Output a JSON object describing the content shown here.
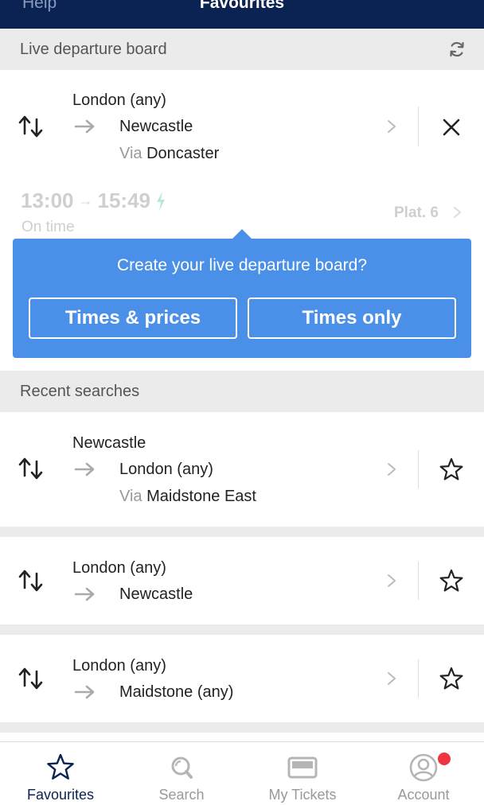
{
  "header": {
    "left": "Help",
    "title": "Favourites"
  },
  "live_board": {
    "title": "Live departure board",
    "journey": {
      "from": "London (any)",
      "to": "Newcastle",
      "via_label": "Via",
      "via": "Doncaster"
    },
    "departure": "13:00",
    "arrival": "15:49",
    "status": "On time",
    "platform": "Plat. 6"
  },
  "popup": {
    "question": "Create your live departure board?",
    "btn_times_prices": "Times & prices",
    "btn_times_only": "Times only"
  },
  "recent": {
    "title": "Recent searches",
    "items": [
      {
        "from": "Newcastle",
        "to": "London (any)",
        "via_label": "Via",
        "via": "Maidstone East"
      },
      {
        "from": "London (any)",
        "to": "Newcastle"
      },
      {
        "from": "London (any)",
        "to": "Maidstone (any)"
      }
    ]
  },
  "tabs": [
    {
      "label": "Favourites",
      "icon": "star-icon",
      "active": true
    },
    {
      "label": "Search",
      "icon": "search-icon"
    },
    {
      "label": "My Tickets",
      "icon": "ticket-icon"
    },
    {
      "label": "Account",
      "icon": "account-icon"
    }
  ],
  "colors": {
    "navy": "#0b2352",
    "popup_blue": "#4a90e8",
    "badge_red": "#ef3340"
  }
}
